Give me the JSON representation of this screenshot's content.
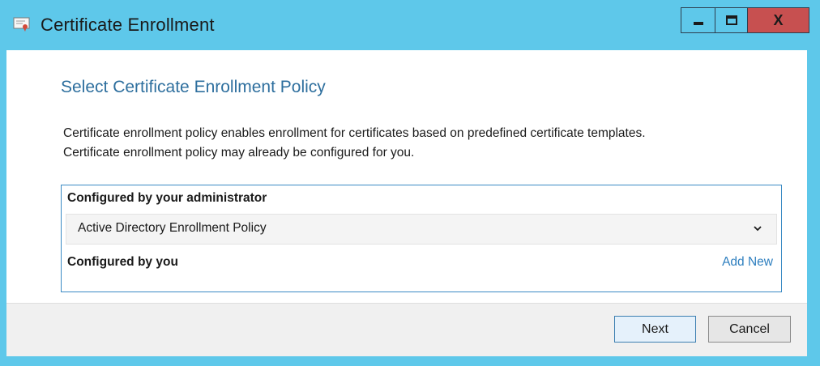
{
  "window": {
    "title": "Certificate Enrollment",
    "icon": "certificate-icon",
    "controls": {
      "minimize": "minimize-icon",
      "maximize": "maximize-icon",
      "close_label": "X"
    }
  },
  "page": {
    "heading": "Select Certificate Enrollment Policy",
    "description_line1": "Certificate enrollment policy enables enrollment for certificates based on predefined certificate templates.",
    "description_line2": "Certificate enrollment policy may already be configured for you."
  },
  "policy": {
    "admin_section_label": "Configured by your administrator",
    "admin_policies": [
      {
        "name": "Active Directory Enrollment Policy",
        "expand_icon": "chevron-down-icon"
      }
    ],
    "user_section_label": "Configured by you",
    "add_new_label": "Add New"
  },
  "buttons": {
    "next_label": "Next",
    "cancel_label": "Cancel"
  },
  "colors": {
    "frame": "#5ec8ea",
    "close_button": "#c75050",
    "heading": "#2e6f9e",
    "link": "#2e7fbf",
    "group_border": "#3a8ac4"
  }
}
